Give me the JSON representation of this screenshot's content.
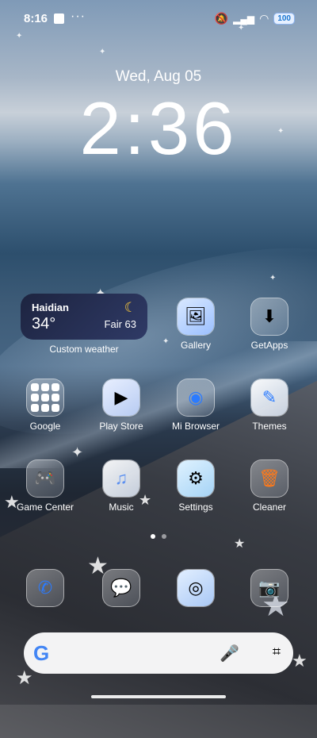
{
  "status": {
    "time": "8:16",
    "battery": "100"
  },
  "lockclock": {
    "date": "Wed, Aug 05",
    "time": "2:36"
  },
  "weather": {
    "city": "Haidian",
    "temp": "34°",
    "condition": "Fair 63",
    "label": "Custom weather"
  },
  "apps": [
    {
      "label": "Gallery",
      "icon": "gallery-icon"
    },
    {
      "label": "GetApps",
      "icon": "getapps-icon"
    },
    {
      "label": "Google",
      "icon": "google-folder-icon"
    },
    {
      "label": "Play Store",
      "icon": "play-store-icon"
    },
    {
      "label": "Mi Browser",
      "icon": "mi-browser-icon"
    },
    {
      "label": "Themes",
      "icon": "themes-icon"
    },
    {
      "label": "Game Center",
      "icon": "game-center-icon"
    },
    {
      "label": "Music",
      "icon": "music-icon"
    },
    {
      "label": "Settings",
      "icon": "settings-icon"
    },
    {
      "label": "Cleaner",
      "icon": "cleaner-icon"
    }
  ],
  "dock": [
    {
      "icon": "phone-icon"
    },
    {
      "icon": "messages-icon"
    },
    {
      "icon": "chrome-icon"
    },
    {
      "icon": "camera-icon"
    }
  ],
  "search": {
    "logo": "G"
  },
  "colors": {
    "accent": "#4285f4",
    "weather_bg": "#1d2440"
  }
}
